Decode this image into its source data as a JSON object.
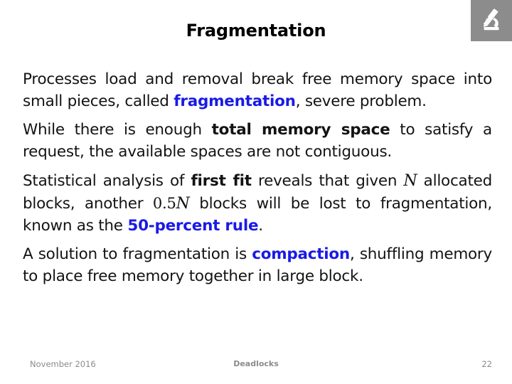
{
  "slide": {
    "title": "Fragmentation",
    "logo_icon": "microscope-icon"
  },
  "content": {
    "paragraphs": [
      {
        "id": "p1",
        "runs": [
          {
            "text": "Processes load and removal break free memory space into small pieces, called ",
            "style": "normal"
          },
          {
            "text": "fragmentation",
            "style": "blue-bold"
          },
          {
            "text": ", severe problem.",
            "style": "normal"
          }
        ]
      },
      {
        "id": "p2",
        "runs": [
          {
            "text": "While there is enough ",
            "style": "normal"
          },
          {
            "text": "total memory space",
            "style": "bold"
          },
          {
            "text": " to satisfy a request, the available spaces are not contiguous.",
            "style": "normal"
          }
        ]
      },
      {
        "id": "p3",
        "runs": [
          {
            "text": "Statistical analysis of ",
            "style": "normal"
          },
          {
            "text": "first fit",
            "style": "bold"
          },
          {
            "text": " reveals that given ",
            "style": "normal"
          },
          {
            "text": "N",
            "style": "math-var"
          },
          {
            "text": " allocated blocks, another ",
            "style": "normal"
          },
          {
            "text": "0.5",
            "style": "math-num"
          },
          {
            "text": "N",
            "style": "math-var"
          },
          {
            "text": " blocks will be lost to fragmentation, known as the ",
            "style": "normal"
          },
          {
            "text": "50-percent rule",
            "style": "blue-bold"
          },
          {
            "text": ".",
            "style": "normal"
          }
        ]
      },
      {
        "id": "p4",
        "runs": [
          {
            "text": "A solution to fragmentation is ",
            "style": "normal"
          },
          {
            "text": "compaction",
            "style": "blue-bold"
          },
          {
            "text": ", shuffling memory to place free memory together in large block.",
            "style": "normal"
          }
        ]
      }
    ]
  },
  "footer": {
    "date": "November 2016",
    "topic": "Deadlocks",
    "page_number": "22"
  },
  "colors": {
    "accent_blue": "#1a1ae6",
    "logo_background": "#8c8c8c",
    "footer_text": "#8b8b8b",
    "body_text": "#131313"
  }
}
